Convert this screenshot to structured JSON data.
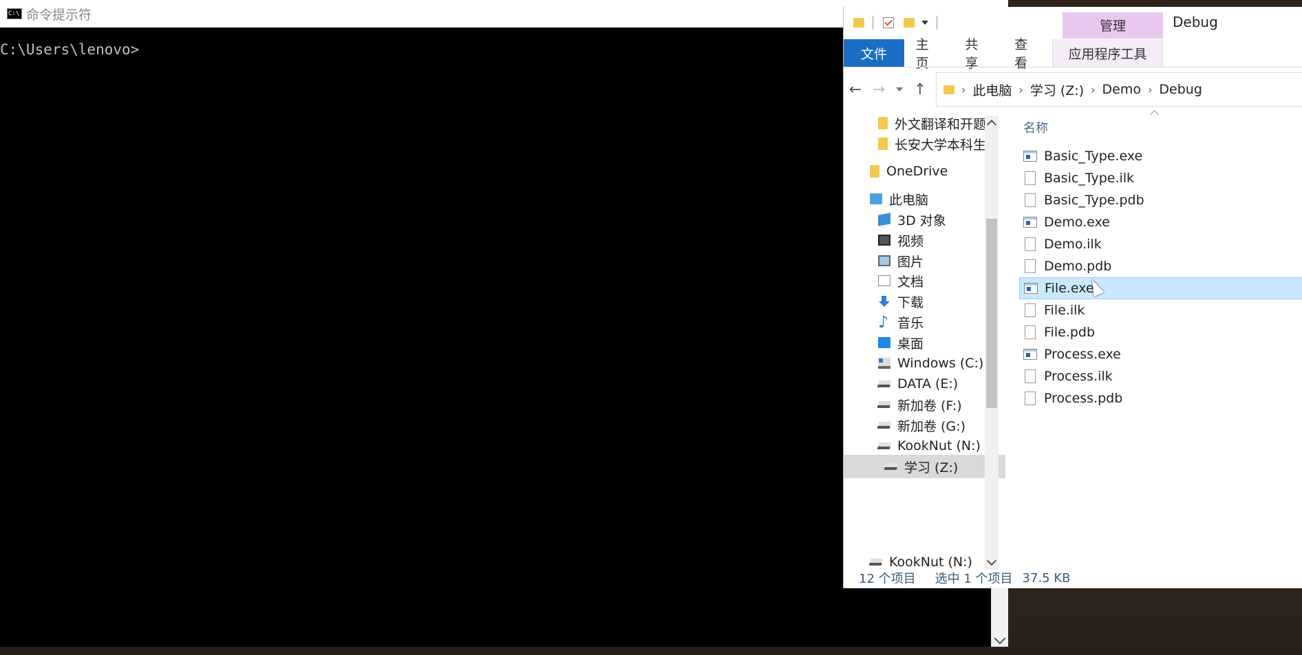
{
  "cmd": {
    "title": "命令提示符",
    "prompt": "C:\\Users\\lenovo>"
  },
  "explorer": {
    "window_title": "Debug",
    "manage_tab": "管理",
    "ribbon": {
      "file": "文件",
      "home": "主页",
      "share": "共享",
      "view": "查看",
      "app_tools": "应用程序工具"
    },
    "breadcrumb": [
      "此电脑",
      "学习 (Z:)",
      "Demo",
      "Debug"
    ],
    "nav": {
      "items": [
        {
          "label": "外文翻译和开题报",
          "icon": "folder-icon"
        },
        {
          "label": "长安大学本科生毕",
          "icon": "folder-icon"
        },
        {
          "label": "OneDrive",
          "icon": "folder-icon"
        },
        {
          "label": "此电脑",
          "icon": "computer-icon"
        },
        {
          "label": "3D 对象",
          "icon": "3d-objects-icon"
        },
        {
          "label": "视频",
          "icon": "video-icon"
        },
        {
          "label": "图片",
          "icon": "pictures-icon"
        },
        {
          "label": "文档",
          "icon": "documents-icon"
        },
        {
          "label": "下载",
          "icon": "download-icon"
        },
        {
          "label": "音乐",
          "icon": "music-icon"
        },
        {
          "label": "桌面",
          "icon": "desktop-icon"
        },
        {
          "label": "Windows (C:)",
          "icon": "windows-drive-icon"
        },
        {
          "label": "DATA (E:)",
          "icon": "drive-icon"
        },
        {
          "label": "新加卷 (F:)",
          "icon": "drive-icon"
        },
        {
          "label": "新加卷 (G:)",
          "icon": "drive-icon"
        },
        {
          "label": "KookNut (N:)",
          "icon": "drive-icon"
        },
        {
          "label": "学习 (Z:)",
          "icon": "drive-icon"
        },
        {
          "label": "KookNut (N:)",
          "icon": "drive-icon"
        }
      ]
    },
    "column_header": "名称",
    "files": [
      {
        "name": "Basic_Type.exe",
        "type": "exe"
      },
      {
        "name": "Basic_Type.ilk",
        "type": "doc"
      },
      {
        "name": "Basic_Type.pdb",
        "type": "doc"
      },
      {
        "name": "Demo.exe",
        "type": "exe"
      },
      {
        "name": "Demo.ilk",
        "type": "doc"
      },
      {
        "name": "Demo.pdb",
        "type": "doc"
      },
      {
        "name": "File.exe",
        "type": "exe",
        "selected": true
      },
      {
        "name": "File.ilk",
        "type": "doc"
      },
      {
        "name": "File.pdb",
        "type": "doc"
      },
      {
        "name": "Process.exe",
        "type": "exe"
      },
      {
        "name": "Process.ilk",
        "type": "doc"
      },
      {
        "name": "Process.pdb",
        "type": "doc"
      }
    ],
    "status": {
      "count": "12 个项目",
      "selection": "选中 1 个项目",
      "size": "37.5 KB"
    }
  }
}
